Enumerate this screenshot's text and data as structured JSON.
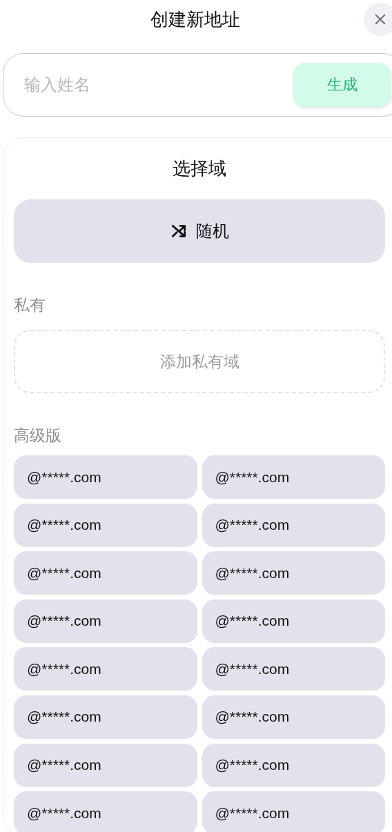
{
  "header": {
    "title": "创建新地址"
  },
  "name_form": {
    "placeholder": "输入姓名",
    "button": "生成"
  },
  "domain_picker": {
    "title": "选择域",
    "random_button": "随机",
    "sections": [
      {
        "kind": "private",
        "label": "私有",
        "add_button": "添加私有域"
      },
      {
        "kind": "premium",
        "label": "高级版",
        "domains": [
          "@*****.com",
          "@*****.com",
          "@*****.com",
          "@*****.com",
          "@*****.com",
          "@*****.com",
          "@*****.com",
          "@*****.com",
          "@*****.com",
          "@*****.com",
          "@*****.com",
          "@*****.com",
          "@*****.com",
          "@*****.com",
          "@*****.com",
          "@*****.com"
        ]
      }
    ]
  }
}
